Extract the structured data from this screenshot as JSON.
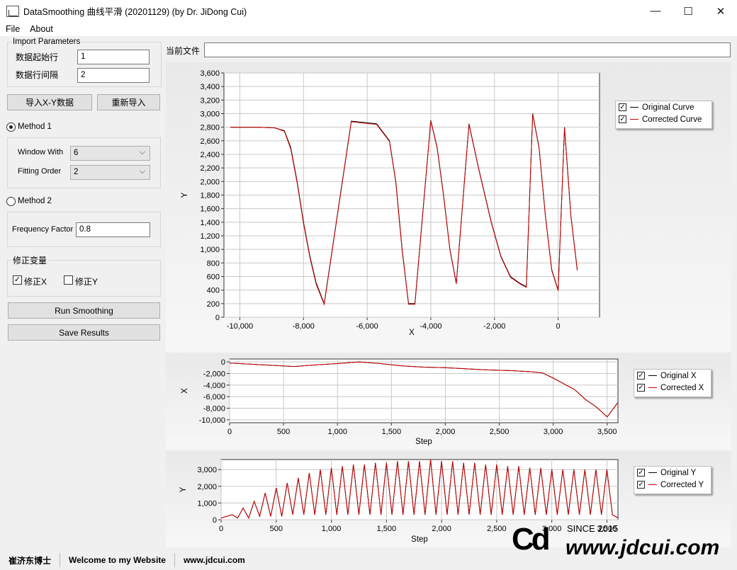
{
  "window": {
    "title": "DataSmoothing 曲线平滑 (20201129) (by Dr. JiDong Cui)",
    "minimize": "—",
    "maximize": "☐",
    "close": "✕"
  },
  "menu": [
    "File",
    "About"
  ],
  "import": {
    "group_label": "Import Parameters",
    "start_row_label": "数据起始行",
    "start_row_value": "1",
    "interval_label": "数据行间隔",
    "interval_value": "2"
  },
  "buttons": {
    "import_xy": "导入X-Y数据",
    "reimport": "重新导入",
    "run": "Run Smoothing",
    "save": "Save Results"
  },
  "method1": {
    "label": "Method 1",
    "checked": true,
    "window_label": "Window With",
    "window_value": "6",
    "order_label": "Fitting Order",
    "order_value": "2"
  },
  "method2": {
    "label": "Method 2",
    "checked": false,
    "freq_label": "Frequency Factor",
    "freq_value": "0.8"
  },
  "correction": {
    "group_label": "修正变量",
    "x_label": "修正X",
    "x_checked": true,
    "y_label": "修正Y",
    "y_checked": false
  },
  "current_file_label": "当前文件",
  "current_file_value": "",
  "chart_data": [
    {
      "type": "line",
      "xlabel": "X",
      "ylabel": "Y",
      "xlim": [
        -10500,
        1300
      ],
      "ylim": [
        0,
        3600
      ],
      "x_ticks": [
        "-10,000",
        "-8,000",
        "-6,000",
        "-4,000",
        "-2,000",
        "0"
      ],
      "y_ticks": [
        "0",
        "200",
        "400",
        "600",
        "800",
        "1,000",
        "1,200",
        "1,400",
        "1,600",
        "1,800",
        "2,000",
        "2,200",
        "2,400",
        "2,600",
        "2,800",
        "3,000",
        "3,200",
        "3,400",
        "3,600"
      ],
      "legend_position": "top-right",
      "series": [
        {
          "name": "Original Curve",
          "color": "#000000",
          "x": [
            -10300,
            -9900,
            -9400,
            -8900,
            -8600,
            -8400,
            -8200,
            -8000,
            -7800,
            -7600,
            -7350,
            -6500,
            -5700,
            -5300,
            -5100,
            -5000,
            -4900,
            -4800,
            -4700,
            -4500,
            -4000,
            -3800,
            -3600,
            -3400,
            -3200,
            -2800,
            -2500,
            -2100,
            -1800,
            -1500,
            -1200,
            -1000,
            -800,
            -600,
            -400,
            -200,
            0,
            200,
            400,
            600
          ],
          "y": [
            2800,
            2800,
            2800,
            2790,
            2750,
            2500,
            2000,
            1400,
            900,
            500,
            200,
            2890,
            2850,
            2600,
            2000,
            1500,
            1000,
            600,
            200,
            200,
            2900,
            2500,
            1800,
            1000,
            500,
            2850,
            2200,
            1400,
            900,
            600,
            500,
            450,
            3000,
            2500,
            1500,
            700,
            400,
            2800,
            1500,
            700
          ]
        },
        {
          "name": "Corrected Curve",
          "color": "#cc0000",
          "x": [
            -10300,
            -9900,
            -9400,
            -8900,
            -8600,
            -8400,
            -8200,
            -8000,
            -7800,
            -7600,
            -7350,
            -6500,
            -5700,
            -5300,
            -5100,
            -5000,
            -4900,
            -4800,
            -4700,
            -4500,
            -4000,
            -3800,
            -3600,
            -3400,
            -3200,
            -2800,
            -2500,
            -2100,
            -1800,
            -1500,
            -1200,
            -1000,
            -800,
            -600,
            -400,
            -200,
            0,
            200,
            400,
            600
          ],
          "y": [
            2800,
            2800,
            2800,
            2790,
            2740,
            2480,
            1980,
            1380,
            880,
            480,
            190,
            2880,
            2840,
            2590,
            1990,
            1480,
            980,
            590,
            190,
            190,
            2890,
            2490,
            1790,
            990,
            490,
            2840,
            2190,
            1390,
            890,
            590,
            490,
            440,
            2990,
            2490,
            1490,
            690,
            390,
            2790,
            1490,
            690
          ]
        }
      ]
    },
    {
      "type": "line",
      "xlabel": "Step",
      "ylabel": "X",
      "xlim": [
        0,
        3600
      ],
      "ylim": [
        -10500,
        500
      ],
      "x_ticks": [
        "0",
        "500",
        "1,000",
        "1,500",
        "2,000",
        "2,500",
        "3,000",
        "3,500"
      ],
      "y_ticks": [
        "0",
        "-2,000",
        "-4,000",
        "-6,000",
        "-8,000",
        "-10,000"
      ],
      "legend_position": "top-right",
      "series": [
        {
          "name": "Original X",
          "color": "#000000",
          "x": [
            0,
            200,
            400,
            600,
            800,
            1000,
            1200,
            1400,
            1600,
            1800,
            2000,
            2200,
            2400,
            2600,
            2800,
            2900,
            3000,
            3100,
            3200,
            3300,
            3400,
            3500,
            3600
          ],
          "y": [
            -200,
            -400,
            -600,
            -800,
            -500,
            -300,
            0,
            -300,
            -700,
            -900,
            -1000,
            -1200,
            -1400,
            -1500,
            -1700,
            -1900,
            -2800,
            -3800,
            -4800,
            -6500,
            -7800,
            -9500,
            -7000
          ]
        },
        {
          "name": "Corrected X",
          "color": "#cc0000",
          "x": [
            0,
            200,
            400,
            600,
            800,
            1000,
            1200,
            1400,
            1600,
            1800,
            2000,
            2200,
            2400,
            2600,
            2800,
            2900,
            3000,
            3100,
            3200,
            3300,
            3400,
            3500,
            3600
          ],
          "y": [
            -200,
            -400,
            -600,
            -800,
            -500,
            -300,
            0,
            -300,
            -700,
            -900,
            -1000,
            -1200,
            -1400,
            -1500,
            -1700,
            -1900,
            -2800,
            -3800,
            -4800,
            -6500,
            -7800,
            -9500,
            -7000
          ]
        }
      ]
    },
    {
      "type": "line",
      "xlabel": "Step",
      "ylabel": "Y",
      "xlim": [
        0,
        3600
      ],
      "ylim": [
        0,
        3600
      ],
      "x_ticks": [
        "0",
        "500",
        "1,000",
        "1,500",
        "2,000",
        "2,500",
        "3,000",
        "3,500"
      ],
      "y_ticks": [
        "0",
        "1,000",
        "2,000",
        "3,000"
      ],
      "legend_position": "top-right",
      "series": [
        {
          "name": "Original Y",
          "color": "#000000",
          "x": [
            0,
            100,
            150,
            200,
            250,
            300,
            350,
            400,
            450,
            500,
            550,
            600,
            650,
            700,
            750,
            800,
            850,
            900,
            950,
            1000,
            1050,
            1100,
            1150,
            1200,
            1250,
            1300,
            1350,
            1400,
            1450,
            1500,
            1550,
            1600,
            1650,
            1700,
            1750,
            1800,
            1850,
            1900,
            1950,
            2000,
            2050,
            2100,
            2150,
            2200,
            2250,
            2300,
            2350,
            2400,
            2450,
            2500,
            2550,
            2600,
            2650,
            2700,
            2750,
            2800,
            2850,
            2900,
            2950,
            3000,
            3050,
            3100,
            3150,
            3200,
            3250,
            3300,
            3350,
            3400,
            3450,
            3500,
            3550,
            3600
          ],
          "y": [
            100,
            300,
            100,
            700,
            100,
            1100,
            200,
            1600,
            200,
            1900,
            200,
            2200,
            300,
            2500,
            300,
            2800,
            300,
            3000,
            300,
            3100,
            300,
            3200,
            300,
            3300,
            300,
            3300,
            300,
            3400,
            300,
            3400,
            300,
            3500,
            300,
            3500,
            300,
            3500,
            300,
            3600,
            300,
            3500,
            300,
            3500,
            300,
            3400,
            300,
            3400,
            300,
            3300,
            300,
            3300,
            300,
            3200,
            300,
            3200,
            300,
            3100,
            300,
            3100,
            300,
            3000,
            300,
            3000,
            300,
            3000,
            300,
            3000,
            300,
            3000,
            300,
            3000,
            300,
            100
          ]
        },
        {
          "name": "Corrected Y",
          "color": "#cc0000",
          "x": [
            0,
            100,
            150,
            200,
            250,
            300,
            350,
            400,
            450,
            500,
            550,
            600,
            650,
            700,
            750,
            800,
            850,
            900,
            950,
            1000,
            1050,
            1100,
            1150,
            1200,
            1250,
            1300,
            1350,
            1400,
            1450,
            1500,
            1550,
            1600,
            1650,
            1700,
            1750,
            1800,
            1850,
            1900,
            1950,
            2000,
            2050,
            2100,
            2150,
            2200,
            2250,
            2300,
            2350,
            2400,
            2450,
            2500,
            2550,
            2600,
            2650,
            2700,
            2750,
            2800,
            2850,
            2900,
            2950,
            3000,
            3050,
            3100,
            3150,
            3200,
            3250,
            3300,
            3350,
            3400,
            3450,
            3500,
            3550,
            3600
          ],
          "y": [
            100,
            300,
            100,
            700,
            100,
            1100,
            200,
            1600,
            200,
            1900,
            200,
            2200,
            300,
            2500,
            300,
            2800,
            300,
            3000,
            300,
            3100,
            300,
            3200,
            300,
            3300,
            300,
            3300,
            300,
            3400,
            300,
            3400,
            300,
            3500,
            300,
            3500,
            300,
            3500,
            300,
            3600,
            300,
            3500,
            300,
            3500,
            300,
            3400,
            300,
            3400,
            300,
            3300,
            300,
            3300,
            300,
            3200,
            300,
            3200,
            300,
            3100,
            300,
            3100,
            300,
            3000,
            300,
            3000,
            300,
            3000,
            300,
            3000,
            300,
            3000,
            300,
            3000,
            300,
            100
          ]
        }
      ]
    }
  ],
  "status": {
    "author": "崔济东博士",
    "welcome": "Welcome to my Website",
    "site": "www.jdcui.com"
  },
  "watermark": {
    "logo": "Cd",
    "since": "SINCE 2015",
    "url": "www.jdcui.com"
  }
}
